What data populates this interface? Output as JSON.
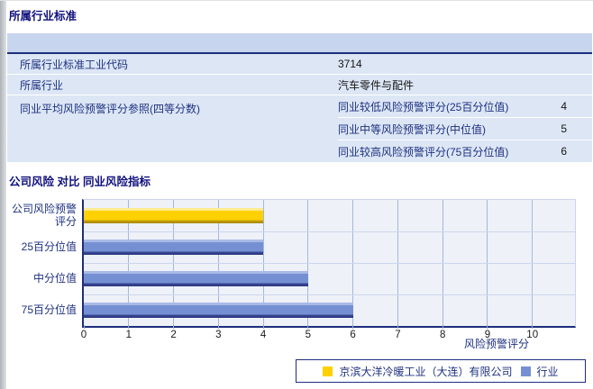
{
  "section1": {
    "title": "所属行业标准",
    "table": {
      "rows": [
        {
          "label": "所属行业标准工业代码",
          "value": "3714"
        },
        {
          "label": "所属行业",
          "value": "汽车零件与配件"
        }
      ],
      "group_row": {
        "label": "同业平均风险预警评分参照(四等分数)",
        "sub_rows": [
          {
            "label": "同业较低风险预警评分(25百分位值)",
            "value": "4"
          },
          {
            "label": "同业中等风险预警评分(中位值)",
            "value": "5"
          },
          {
            "label": "同业较高风险预警评分(75百分位值)",
            "value": "6"
          }
        ]
      }
    }
  },
  "section2": {
    "title": "公司风险 对比 同业风险指标"
  },
  "chart_data": {
    "type": "bar",
    "orientation": "horizontal",
    "title": "公司风险 对比 同业风险指标",
    "categories": [
      "公司风险预警评分",
      "25百分位值",
      "中分位值",
      "75百分位值"
    ],
    "category_display": [
      [
        "公司风险预警",
        "评分"
      ],
      [
        "25百分位值"
      ],
      [
        "中分位值"
      ],
      [
        "75百分位值"
      ]
    ],
    "values": [
      4,
      4,
      5,
      6
    ],
    "bar_series": [
      "company",
      "industry",
      "industry",
      "industry"
    ],
    "xlabel": "风险预警评分",
    "xticks": [
      0,
      1,
      2,
      3,
      4,
      5,
      6,
      7,
      8,
      9,
      10
    ],
    "xlim": [
      0,
      10.95
    ],
    "grid": "vertical",
    "legend_position": "bottom",
    "legend": [
      {
        "name": "京滨大洋冷暖工业（大连）有限公司",
        "color": "#ffd103",
        "series": "company"
      },
      {
        "name": "行业",
        "color": "#7590d2",
        "series": "industry"
      }
    ],
    "colors": {
      "company": "#ffd103",
      "industry": "#7590d2",
      "axis": "#1e2e7e",
      "plot_bg": "#eef1f7"
    }
  }
}
